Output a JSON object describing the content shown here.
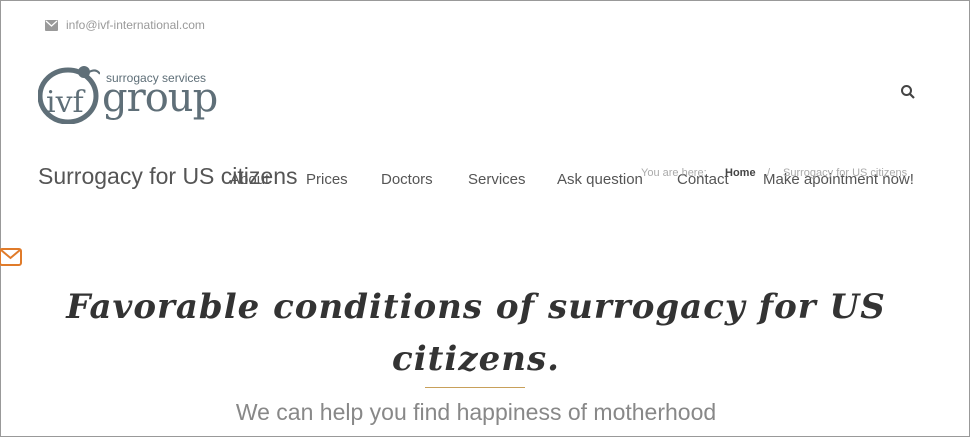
{
  "topbar": {
    "email": "info@ivf-international.com"
  },
  "logo": {
    "mark": "ivf",
    "word": "group",
    "tagline": "surrogacy services"
  },
  "page": {
    "heading": "Surrogacy for US citizens"
  },
  "nav": {
    "items": [
      {
        "label": "About"
      },
      {
        "label": "Prices"
      },
      {
        "label": "Doctors"
      },
      {
        "label": "Services"
      },
      {
        "label": "Ask question"
      },
      {
        "label": "Contact"
      },
      {
        "label": "Make apointment now!"
      }
    ]
  },
  "breadcrumb": {
    "prefix": "You are here:",
    "home": "Home",
    "separator": "/",
    "current": "Surrogacy for US citizens"
  },
  "hero": {
    "title": "Favorable conditions of surrogacy for US citizens.",
    "subtitle": "We can help you find happiness of motherhood"
  },
  "colors": {
    "accent": "#c8a05a",
    "logo": "#5f6f78",
    "float_mail": "#e07b2a"
  },
  "icons": {
    "search": "search-icon",
    "mail": "mail-icon",
    "float": "envelope-icon"
  }
}
